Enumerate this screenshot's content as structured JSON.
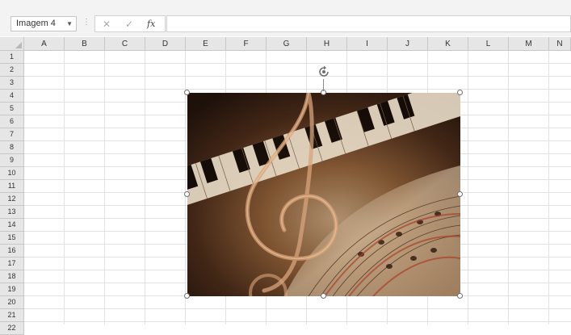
{
  "name_box": {
    "value": "Imagem 4"
  },
  "formula_bar": {
    "cancel_glyph": "✕",
    "enter_glyph": "✓",
    "fx_label": "fx",
    "value": ""
  },
  "columns": [
    "A",
    "B",
    "C",
    "D",
    "E",
    "F",
    "G",
    "H",
    "I",
    "J",
    "K",
    "L",
    "M",
    "N"
  ],
  "rows": [
    "1",
    "2",
    "3",
    "4",
    "5",
    "6",
    "7",
    "8",
    "9",
    "10",
    "11",
    "12",
    "13",
    "14",
    "15",
    "16",
    "17",
    "18",
    "19",
    "20",
    "21",
    "22"
  ],
  "selected_object": {
    "type": "picture",
    "name": "Imagem 4",
    "description": "treble clef over piano keys and sheet music"
  },
  "icons": {
    "rotate": "rotate-handle-icon",
    "name_box_dropdown": "chevron-down-icon",
    "select_all": "select-all-triangle-icon"
  }
}
